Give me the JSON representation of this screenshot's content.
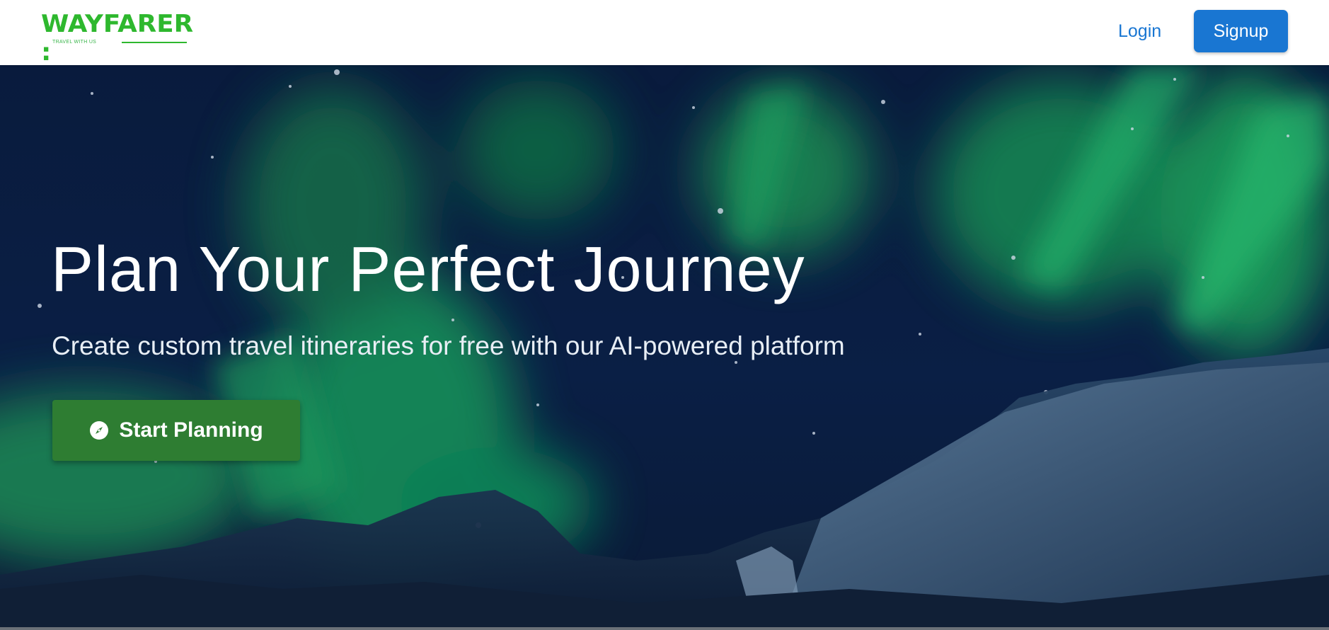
{
  "header": {
    "logo": {
      "wordmark": "WAYFARER :",
      "tagline": "TRAVEL WITH US"
    },
    "login_label": "Login",
    "signup_label": "Signup"
  },
  "hero": {
    "title": "Plan Your Perfect Journey",
    "subtitle": "Create custom travel itineraries for free with our AI-powered platform",
    "cta_label": "Start Planning",
    "cta_icon": "compass-icon",
    "background": "aurora-night-sky-mountains"
  },
  "colors": {
    "brand_green": "#2eb82e",
    "primary_blue": "#1976d2",
    "cta_green": "#2e7d32",
    "aurora_green": "#1fa35b",
    "sky_navy": "#0a1f45"
  }
}
